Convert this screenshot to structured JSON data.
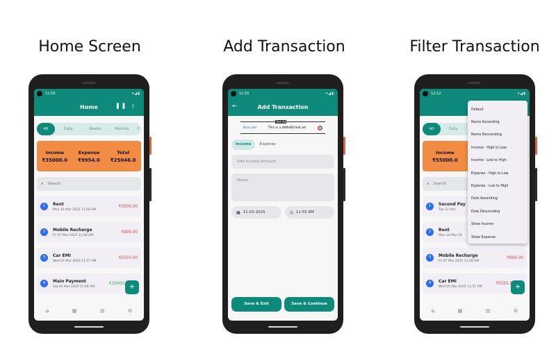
{
  "captions": {
    "home": "Home Screen",
    "add": "Add Transaction",
    "filter": "Filter Transaction"
  },
  "colors": {
    "primary": "#0d8a79",
    "summary": "#f28c44",
    "expense": "#e04848",
    "income": "#3aa35a",
    "index_badge": "#2d6cf0"
  },
  "icons": {
    "wifi_battery": "▾◢▮",
    "chart": "chart-icon",
    "more": "more-vert-icon",
    "back": "arrow-back-icon",
    "search": "search-icon",
    "home": "home-icon",
    "calendar": "calendar-icon",
    "report": "document-icon",
    "settings": "settings-icon",
    "clock": "clock-icon",
    "add": "plus-icon"
  },
  "home": {
    "time": "11:59",
    "title": "Home",
    "tabs": [
      "All",
      "Daily",
      "Weekly",
      "Monthly",
      "Y"
    ],
    "summary": {
      "income_label": "Income",
      "income_value": "₹35000.0",
      "expense_label": "Expense",
      "expense_value": "₹9954.0",
      "total_label": "Total",
      "total_value": "₹25046.0"
    },
    "search_placeholder": "Search",
    "transactions": [
      {
        "n": "1",
        "title": "Rent",
        "date": "Mon 10 Mar 2025 11:58 AM",
        "amount": "₹3500.00"
      },
      {
        "n": "2",
        "title": "Mobile Recharge",
        "date": "Fri 07 Mar 2025 11:58 AM",
        "amount": "₹899.00"
      },
      {
        "n": "3",
        "title": "Car EMI",
        "date": "Wed 05 Mar 2025 11:57 AM",
        "amount": "₹5555.00"
      },
      {
        "n": "4",
        "title": "Main Payment",
        "date": "Sat 01 Mar 2025 11:56 AM",
        "amount": "₹35000.00"
      }
    ]
  },
  "add": {
    "time": "11:55",
    "title": "Add Transaction",
    "ad": {
      "left": "Nice job!",
      "badge": "Test Ad",
      "text": "This is a 468x60 test ad."
    },
    "types": [
      "Income",
      "Expense"
    ],
    "amount_placeholder": "Add Income Amount",
    "notes_placeholder": "Notes",
    "date": "11-03-2025",
    "time_value": "11:55 AM",
    "save_exit": "Save & Exit",
    "save_continue": "Save & Continue"
  },
  "filter": {
    "time": "12:12",
    "tabs": [
      "All",
      "Daily"
    ],
    "summary": {
      "income_label": "Income",
      "income_value": "₹55000.0",
      "expense_label": "E",
      "expense_value": "₹"
    },
    "search_placeholder": "Search",
    "transactions": [
      {
        "n": "1",
        "title": "Second Pay",
        "date": "Tue 11 Mar",
        "amount": ""
      },
      {
        "n": "2",
        "title": "Rent",
        "date": "Mon 10 Mar 20",
        "amount": ""
      },
      {
        "n": "3",
        "title": "Mobile Recharge",
        "date": "Fri 07 Mar 2025 11:58 AM",
        "amount": "₹899.00"
      },
      {
        "n": "4",
        "title": "Car EMI",
        "date": "Wed 05 Mar 2025 11:57 AM",
        "amount": "₹5555.00"
      }
    ],
    "menu": [
      "Default",
      "Name Ascending",
      "Name Descending",
      "Income - High to Low",
      "Income - Low to High",
      "Expense - High to Low",
      "Expense - Low to High",
      "Date Ascending",
      "Date Descending",
      "Show Income",
      "Show Expense"
    ]
  }
}
